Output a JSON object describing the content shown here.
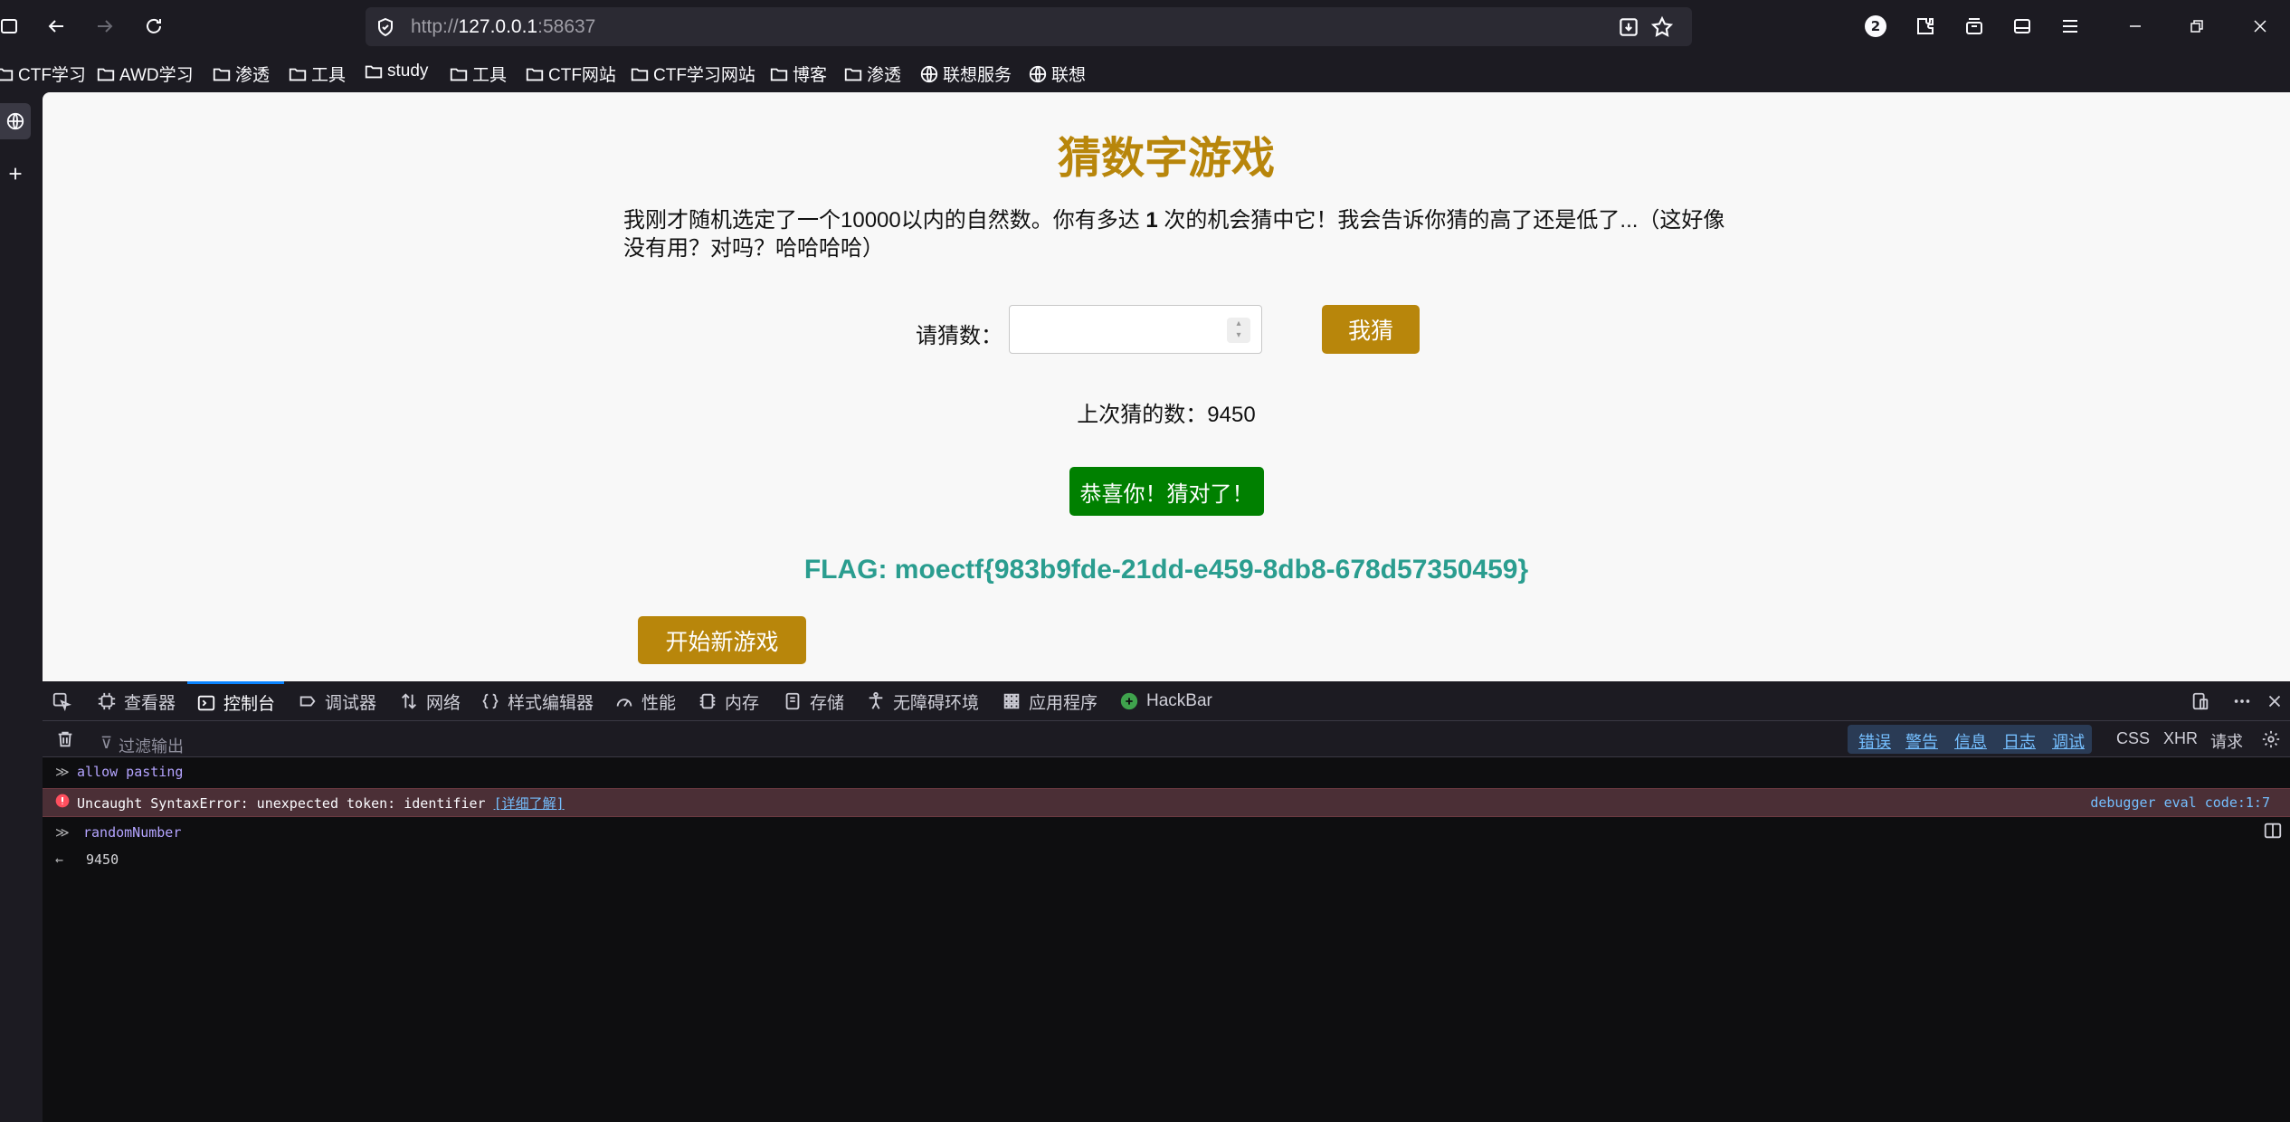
{
  "browser": {
    "url_scheme": "http://",
    "url_host": "127.0.0.1",
    "url_port": ":58637",
    "badge_count": "2"
  },
  "bookmarks": [
    {
      "label": "CTF学习",
      "icon": "folder-icon"
    },
    {
      "label": "AWD学习",
      "icon": "folder-icon"
    },
    {
      "label": "渗透",
      "icon": "folder-icon"
    },
    {
      "label": "工具",
      "icon": "folder-icon"
    },
    {
      "label": "study",
      "icon": "folder-icon"
    },
    {
      "label": "工具",
      "icon": "folder-icon"
    },
    {
      "label": "CTF网站",
      "icon": "folder-icon"
    },
    {
      "label": "CTF学习网站",
      "icon": "folder-icon"
    },
    {
      "label": "博客",
      "icon": "folder-icon"
    },
    {
      "label": "渗透",
      "icon": "folder-icon"
    },
    {
      "label": "联想服务",
      "icon": "globe-icon"
    },
    {
      "label": "联想",
      "icon": "globe-icon"
    }
  ],
  "page": {
    "title": "猜数字游戏",
    "intro_before": "我刚才随机选定了一个10000以内的自然数。你有多达 ",
    "intro_chances": "1",
    "intro_after": " 次的机会猜中它！我会告诉你猜的高了还是低了...（这好像没有用？对吗？哈哈哈哈）",
    "guess_label": "请猜数：",
    "guess_value": "",
    "guess_button": "我猜",
    "last_guess_label": "上次猜的数：9450",
    "success_message": "恭喜你！猜对了！",
    "flag": "FLAG: moectf{983b9fde-21dd-e459-8db8-678d57350459}",
    "new_game_button": "开始新游戏",
    "colors": {
      "accent": "#b8860b",
      "success": "#008000",
      "flag": "#2a9d8f"
    }
  },
  "devtools": {
    "tabs": [
      {
        "label": "查看器",
        "icon": "inspector-icon"
      },
      {
        "label": "控制台",
        "icon": "console-icon"
      },
      {
        "label": "调试器",
        "icon": "debugger-icon"
      },
      {
        "label": "网络",
        "icon": "network-icon"
      },
      {
        "label": "样式编辑器",
        "icon": "style-editor-icon"
      },
      {
        "label": "性能",
        "icon": "performance-icon"
      },
      {
        "label": "内存",
        "icon": "memory-icon"
      },
      {
        "label": "存储",
        "icon": "storage-icon"
      },
      {
        "label": "无障碍环境",
        "icon": "accessibility-icon"
      },
      {
        "label": "应用程序",
        "icon": "application-icon"
      },
      {
        "label": "HackBar",
        "icon": "hackbar-icon"
      }
    ],
    "filter_placeholder": "过滤输出",
    "levels": [
      "错误",
      "警告",
      "信息",
      "日志",
      "调试"
    ],
    "options": [
      "CSS",
      "XHR",
      "请求"
    ],
    "console_lines": {
      "input1": "allow pasting",
      "error_text": "Uncaught SyntaxError: unexpected token: identifier ",
      "error_link": "[详细了解]",
      "error_source": "debugger eval code:1:7",
      "input2": "randomNumber",
      "output2": "9450"
    }
  }
}
